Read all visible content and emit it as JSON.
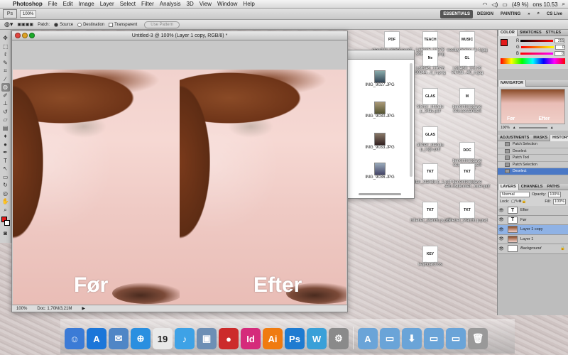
{
  "menubar": {
    "app_name": "Photoshop",
    "items": [
      "File",
      "Edit",
      "Image",
      "Layer",
      "Select",
      "Filter",
      "Analysis",
      "3D",
      "View",
      "Window",
      "Help"
    ],
    "battery": "(49 %)",
    "clock": "ons 10.53"
  },
  "appbar": {
    "logo": "Ps",
    "zoom": "100%",
    "workspaces": [
      "ESSENTIALS",
      "DESIGN",
      "PAINTING"
    ],
    "more": "»",
    "cs_live": "CS Live"
  },
  "options": {
    "patch_label": "Patch:",
    "source_label": "Source",
    "destination_label": "Destination",
    "transparent_label": "Transparent",
    "use_pattern_label": "Use Pattern"
  },
  "document": {
    "title": "Untitled-3 @ 100% (Layer 1 copy, RGB/8) *",
    "label_before": "Før",
    "label_after": "Efter",
    "status_zoom": "100%",
    "status_doc": "Doc: 1,70M/3,21M"
  },
  "finder": {
    "files": [
      "IMG_9027.JPG",
      "IMG_9030.JPG",
      "IMG_9033.JPG",
      "IMG_9036.JPG"
    ]
  },
  "desktop_icons": [
    {
      "label": "standup_plakat e.pdf",
      "img": "PDF"
    },
    {
      "label": "L66245_11678 90844...ab.png",
      "img": "TEACH"
    },
    {
      "label": "vestbyskolen_jk 4.jpg",
      "img": "MUSIC"
    },
    {
      "label": "L66245_11678 90844...s_n.png",
      "img": "Ne"
    },
    {
      "label": "L90430_12179 74788...40_n.jpg",
      "img": "GL"
    },
    {
      "label": "tilleter_standu p_Glas.pdf",
      "img": "GLAS"
    },
    {
      "label": "tjenenteopgave seb.bestandsfil",
      "img": "M"
    },
    {
      "label": "tilleter_standu p_logo.pdf",
      "img": "GLAS"
    },
    {
      "label": "tjenenteopgave seb.bestandsfil ...ktx.pdf",
      "img": "DOC"
    },
    {
      "label": "tilleter_standu p_1.pdf",
      "img": "TKT"
    },
    {
      "label": "tjenenteopgave seb.1stiknoter...ouer.pdf",
      "img": "TKT"
    },
    {
      "label": "billetter_standu p.pdf",
      "img": "TKT"
    },
    {
      "label": "billetter_standu p.psd",
      "img": "TKT"
    },
    {
      "label": "keyboard.ixs",
      "img": "KEY"
    }
  ],
  "panels": {
    "color_tabs": [
      "COLOR",
      "SWATCHES",
      "STYLES"
    ],
    "rgb": [
      {
        "name": "R",
        "value": "255"
      },
      {
        "name": "G",
        "value": "0"
      },
      {
        "name": "B",
        "value": "0"
      }
    ],
    "navigator_tab": "NAVIGATOR",
    "nav_labels": [
      "Før",
      "Efter"
    ],
    "nav_zoom": "100%",
    "history_tabs": [
      "ADJUSTMENTS",
      "MASKS",
      "HISTORY"
    ],
    "history_items": [
      "Patch Selection",
      "Deselect",
      "Patch Tool",
      "Patch Selection",
      "Deselect"
    ],
    "layers_tabs": [
      "LAYERS",
      "CHANNELS",
      "PATHS"
    ],
    "blend_mode": "Normal",
    "opacity_label": "Opacity:",
    "opacity_value": "100%",
    "lock_label": "Lock:",
    "fill_label": "Fill:",
    "fill_value": "100%",
    "layers": [
      {
        "name": "Efter",
        "type": "T"
      },
      {
        "name": "Før",
        "type": "T"
      },
      {
        "name": "Layer 1 copy",
        "type": "img"
      },
      {
        "name": "Layer 1",
        "type": "img"
      },
      {
        "name": "Background",
        "type": "bg"
      }
    ]
  },
  "dock": {
    "apps": [
      {
        "name": "Finder",
        "label": "☺",
        "color": "#3b7bd6"
      },
      {
        "name": "App Store",
        "label": "A",
        "color": "#1b76d9"
      },
      {
        "name": "Preview",
        "label": "✉",
        "color": "#4f86c6"
      },
      {
        "name": "Safari",
        "label": "⊕",
        "color": "#2a8fe0"
      },
      {
        "name": "Calendar",
        "label": "19",
        "color": "#e9e9e9"
      },
      {
        "name": "iTunes",
        "label": "♪",
        "color": "#3ea2e6"
      },
      {
        "name": "iPhoto",
        "label": "▣",
        "color": "#6d8fb5"
      },
      {
        "name": "Angry Birds",
        "label": "●",
        "color": "#cc2b2b"
      },
      {
        "name": "InDesign",
        "label": "Id",
        "color": "#d52b7b"
      },
      {
        "name": "Illustrator",
        "label": "Ai",
        "color": "#f07b10"
      },
      {
        "name": "Photoshop",
        "label": "Ps",
        "color": "#1e7bd1"
      },
      {
        "name": "Word",
        "label": "W",
        "color": "#39a0d8"
      },
      {
        "name": "System Preferences",
        "label": "⚙",
        "color": "#8a8a8a"
      }
    ],
    "right": [
      {
        "name": "Applications",
        "label": "A",
        "color": "#6aa4d8"
      },
      {
        "name": "Documents",
        "label": "▭",
        "color": "#6aa4d8"
      },
      {
        "name": "Downloads",
        "label": "⬇",
        "color": "#6aa4d8"
      },
      {
        "name": "Folder",
        "label": "▭",
        "color": "#6aa4d8"
      },
      {
        "name": "Folder 2",
        "label": "▭",
        "color": "#6aa4d8"
      },
      {
        "name": "Trash",
        "label": "🗑",
        "color": "#999"
      }
    ]
  }
}
